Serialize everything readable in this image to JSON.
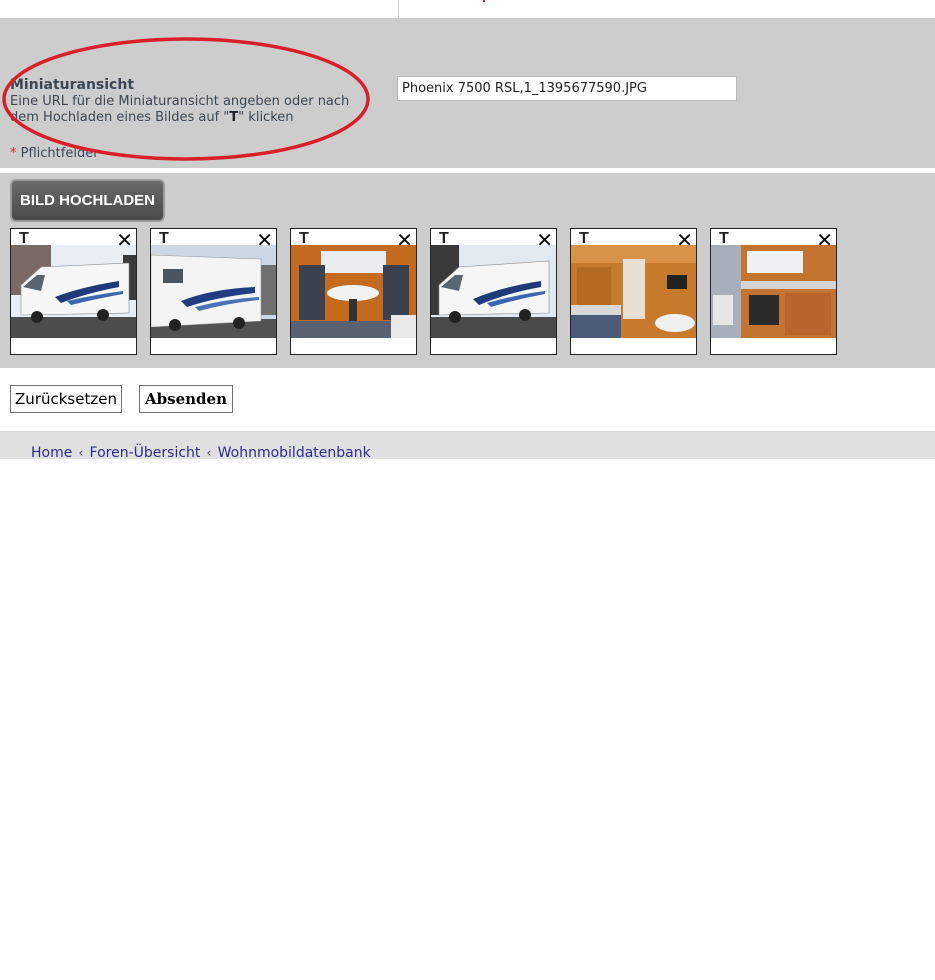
{
  "field": {
    "title": "Miniaturansicht",
    "description_pre": "Eine URL für die Miniaturansicht angeben oder nach dem Hochladen eines Bildes auf \"",
    "description_key": "T",
    "description_post": "\" klicken",
    "input_value": "Phoenix 7500 RSL,1_1395677590.JPG",
    "required_star": "*",
    "required_label": "Pflichtfelder"
  },
  "upload": {
    "button_label": "BILD HOCHLADEN",
    "thumbnails": [
      {
        "t_label": "T",
        "remove_icon": "close-icon",
        "photo": "motorhome-exterior-front"
      },
      {
        "t_label": "T",
        "remove_icon": "close-icon",
        "photo": "motorhome-exterior-side"
      },
      {
        "t_label": "T",
        "remove_icon": "close-icon",
        "photo": "motorhome-interior-dinette"
      },
      {
        "t_label": "T",
        "remove_icon": "close-icon",
        "photo": "motorhome-exterior-front"
      },
      {
        "t_label": "T",
        "remove_icon": "close-icon",
        "photo": "motorhome-interior-kitchen"
      },
      {
        "t_label": "T",
        "remove_icon": "close-icon",
        "photo": "motorhome-interior-galley"
      }
    ]
  },
  "form": {
    "reset_label": "Zurücksetzen",
    "submit_label": "Absenden"
  },
  "breadcrumb": {
    "items": [
      "Home",
      "Foren-Übersicht",
      "Wohnmobildatenbank"
    ],
    "separator": "‹"
  },
  "colors": {
    "section_bg": "#cdcdcd",
    "annotation_ellipse": "#d8202a",
    "link": "#2a2e8a"
  }
}
